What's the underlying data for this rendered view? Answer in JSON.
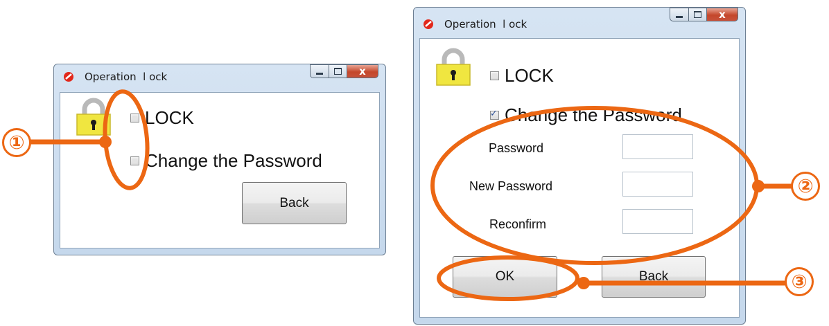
{
  "window1": {
    "title": "Operation  l ock",
    "lock_label": "LOCK",
    "change_password_label": "Change the Password",
    "back_label": "Back",
    "lock_checked": false,
    "change_password_checked": false
  },
  "window2": {
    "title": "Operation  l ock",
    "lock_label": "LOCK",
    "change_password_label": "Change the Password",
    "lock_checked": false,
    "change_password_checked": true,
    "fields": [
      {
        "label": "Password",
        "value": ""
      },
      {
        "label": "New Password",
        "value": ""
      },
      {
        "label": "Reconfirm",
        "value": ""
      }
    ],
    "ok_label": "OK",
    "back_label": "Back"
  },
  "annotations": {
    "color": "#ec6713",
    "markers": [
      "①",
      "②",
      "③"
    ]
  },
  "colors": {
    "lock_body": "#f0e640",
    "close_button": "#c4472b",
    "app_icon": "#e2281b"
  }
}
